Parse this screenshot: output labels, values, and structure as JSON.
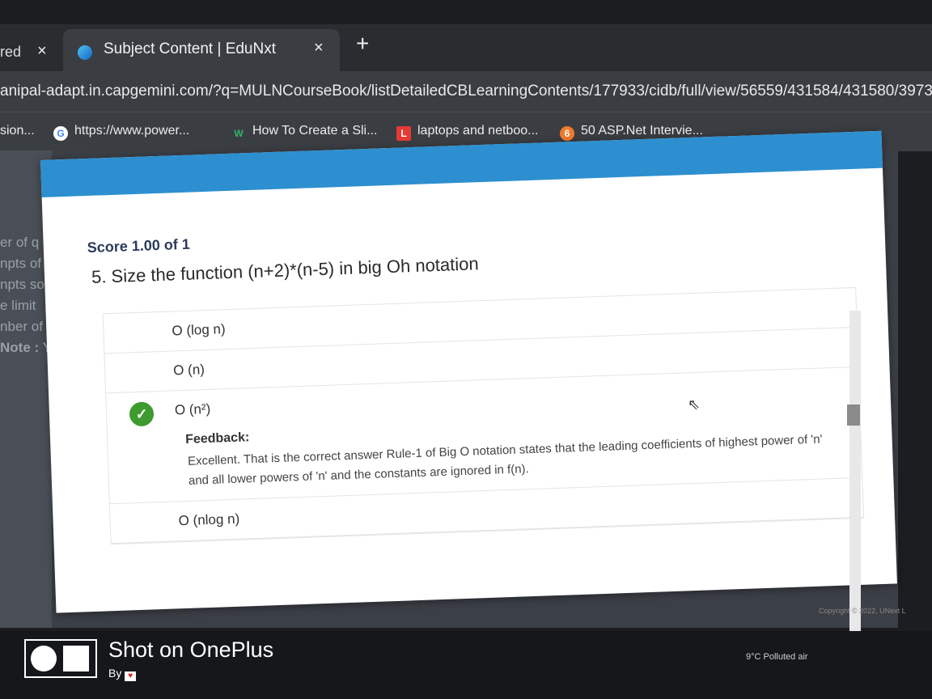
{
  "browser": {
    "inactive_tab": {
      "title": "red",
      "close": "×"
    },
    "active_tab": {
      "title": "Subject Content | EduNxt",
      "close": "×"
    },
    "new_tab": "+",
    "url": "anipal-adapt.in.capgemini.com/?q=MULNCourseBook/listDetailedCBLearningContents/177933/cidb/full/view/56559/431584/431580/39738",
    "bookmarks": [
      {
        "label": "sion...",
        "icon": ""
      },
      {
        "label": "https://www.power...",
        "icon": "google-icon"
      },
      {
        "label": "How To Create a Sli...",
        "icon": "w-icon"
      },
      {
        "label": "laptops and netboo...",
        "icon": "l-icon"
      },
      {
        "label": "50 ASP.Net Intervie...",
        "icon": "orange-circle-icon"
      }
    ]
  },
  "sidebar_fragments": [
    "er of q",
    "npts of",
    "npts so",
    "e limit",
    "nber of q",
    "Note : Yo"
  ],
  "quiz": {
    "score": "Score 1.00 of 1",
    "question": "5. Size the function (n+2)*(n-5) in big Oh notation",
    "options": [
      {
        "label": "O (log n)",
        "correct": false
      },
      {
        "label": "O (n)",
        "correct": false
      },
      {
        "label": "O (n²)",
        "correct": true
      },
      {
        "label": "O (nlog n)",
        "correct": false
      }
    ],
    "feedback_label": "Feedback:",
    "feedback_text": "Excellent. That is the correct answer Rule-1 of Big O notation states that the leading coefficients of highest power of 'n' and all lower powers of 'n' and the constants are ignored in f(n).",
    "check_icon": "✓"
  },
  "footer": {
    "copyright": "Copyright © 2022, UNext L",
    "weather": "9°C  Polluted air"
  },
  "watermark": {
    "title": "Shot on OnePlus",
    "by": "By"
  },
  "colors": {
    "header_blue": "#2d8fcf",
    "check_green": "#3e9b2f"
  }
}
